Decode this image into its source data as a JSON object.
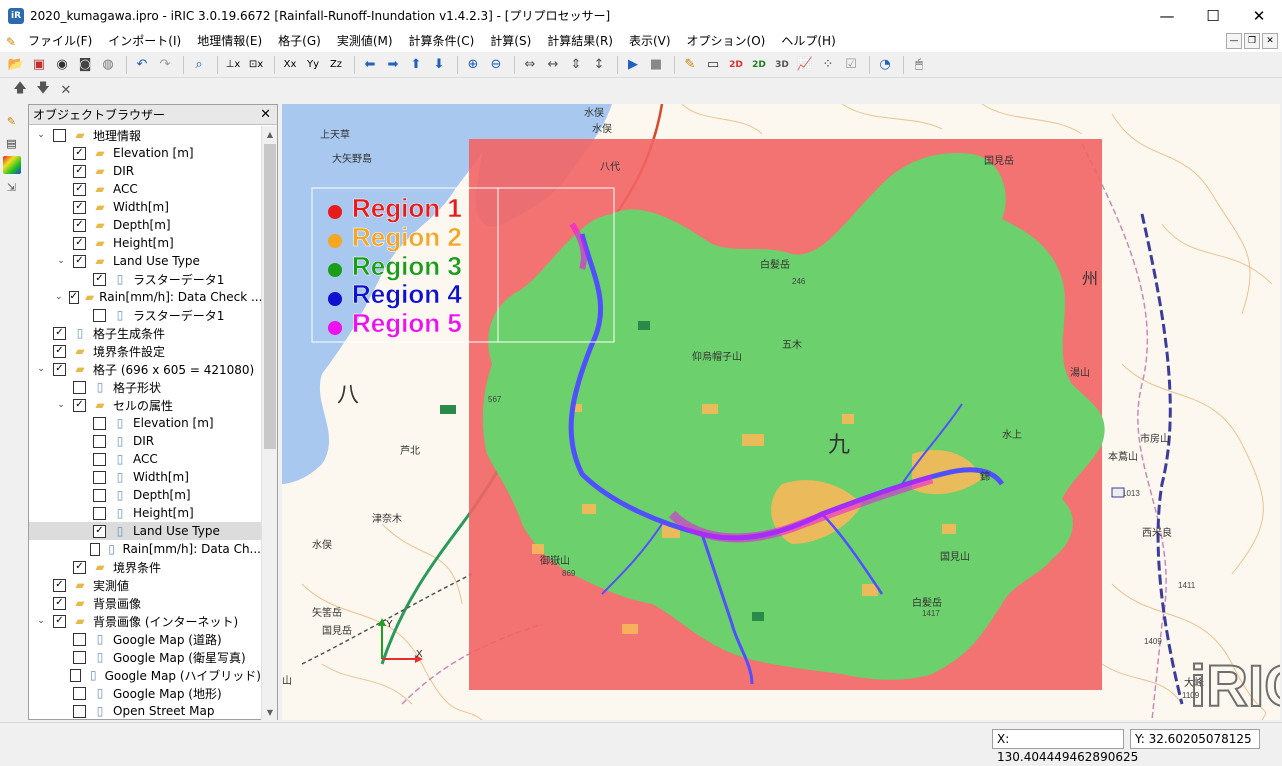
{
  "window": {
    "title": "2020_kumagawa.ipro - iRIC 3.0.19.6672 [Rainfall-Runoff-Inundation v1.4.2.3] - [プリプロセッサー]",
    "app_icon": "iRIC-app-icon",
    "controls": [
      "minimize-icon",
      "maximize-icon",
      "close-icon"
    ]
  },
  "menu": [
    "ファイル(F)",
    "インポート(I)",
    "地理情報(E)",
    "格子(G)",
    "実測値(M)",
    "計算条件(C)",
    "計算(S)",
    "計算結果(R)",
    "表示(V)",
    "オプション(O)",
    "ヘルプ(H)"
  ],
  "toolbar": {
    "icons": [
      "open-folder-icon",
      "save-icon",
      "disk-icon",
      "save-as-icon",
      "cd-icon",
      "undo-icon",
      "redo-icon",
      "zoom-box-icon",
      "x-axis-icon",
      "axis-scale-icon",
      "reverse-x-icon",
      "reverse-y-icon",
      "reverse-z-icon",
      "arrow-left-icon",
      "arrow-right-icon",
      "arrow-up-icon",
      "arrow-down-icon",
      "zoom-in-icon",
      "zoom-out-icon",
      "move-h-icon",
      "move-h2-icon",
      "move-v-icon",
      "move-v2-icon",
      "run-icon",
      "stop-icon",
      "pencil-icon",
      "screen-icon",
      "color-2d-icon",
      "grid-2d-icon",
      "view-3d-icon",
      "graph-icon",
      "scatter-icon",
      "check-icon",
      "globe-icon",
      "mouse-icon"
    ]
  },
  "toolbar2": {
    "icons": [
      "move-up-icon",
      "move-down-icon",
      "delete-icon"
    ]
  },
  "side_tools": [
    "edit-properties-icon",
    "display-setting-icon",
    "colormap-icon",
    "attribute-browser-icon"
  ],
  "object_browser": {
    "title": "オブジェクトブラウザー",
    "close_icon": "close-icon",
    "items": [
      {
        "label": "地理情報",
        "level": 0,
        "expand": "v",
        "checked": false,
        "icon": "folder-icon"
      },
      {
        "label": "Elevation [m]",
        "level": 1,
        "expand": "",
        "checked": true,
        "icon": "folder-icon"
      },
      {
        "label": "DIR",
        "level": 1,
        "expand": "",
        "checked": true,
        "icon": "folder-icon"
      },
      {
        "label": "ACC",
        "level": 1,
        "expand": "",
        "checked": true,
        "icon": "folder-icon"
      },
      {
        "label": "Width[m]",
        "level": 1,
        "expand": "",
        "checked": true,
        "icon": "folder-icon"
      },
      {
        "label": "Depth[m]",
        "level": 1,
        "expand": "",
        "checked": true,
        "icon": "folder-icon"
      },
      {
        "label": "Height[m]",
        "level": 1,
        "expand": "",
        "checked": true,
        "icon": "folder-icon"
      },
      {
        "label": "Land Use Type",
        "level": 1,
        "expand": "v",
        "checked": true,
        "icon": "folder-icon"
      },
      {
        "label": "ラスターデータ1",
        "level": 2,
        "expand": "",
        "checked": true,
        "icon": "document-icon"
      },
      {
        "label": "Rain[mm/h]: Data Check ...",
        "level": 1,
        "expand": "v",
        "checked": true,
        "icon": "folder-icon"
      },
      {
        "label": "ラスターデータ1",
        "level": 2,
        "expand": "",
        "checked": false,
        "icon": "document-icon"
      },
      {
        "label": "格子生成条件",
        "level": 0,
        "expand": "",
        "checked": true,
        "icon": "document-icon"
      },
      {
        "label": "境界条件設定",
        "level": 0,
        "expand": "",
        "checked": true,
        "icon": "folder-icon"
      },
      {
        "label": "格子 (696 x 605 = 421080)",
        "level": 0,
        "expand": "v",
        "checked": true,
        "icon": "folder-icon"
      },
      {
        "label": "格子形状",
        "level": 1,
        "expand": "",
        "checked": false,
        "icon": "document-icon"
      },
      {
        "label": "セルの属性",
        "level": 1,
        "expand": "v",
        "checked": true,
        "icon": "folder-icon"
      },
      {
        "label": "Elevation [m]",
        "level": 2,
        "expand": "",
        "checked": false,
        "icon": "document-icon"
      },
      {
        "label": "DIR",
        "level": 2,
        "expand": "",
        "checked": false,
        "icon": "document-icon"
      },
      {
        "label": "ACC",
        "level": 2,
        "expand": "",
        "checked": false,
        "icon": "document-icon"
      },
      {
        "label": "Width[m]",
        "level": 2,
        "expand": "",
        "checked": false,
        "icon": "document-icon"
      },
      {
        "label": "Depth[m]",
        "level": 2,
        "expand": "",
        "checked": false,
        "icon": "document-icon"
      },
      {
        "label": "Height[m]",
        "level": 2,
        "expand": "",
        "checked": false,
        "icon": "document-icon"
      },
      {
        "label": "Land Use Type",
        "level": 2,
        "expand": "",
        "checked": true,
        "icon": "document-icon",
        "selected": true
      },
      {
        "label": "Rain[mm/h]: Data Ch...",
        "level": 2,
        "expand": "",
        "checked": false,
        "icon": "document-icon"
      },
      {
        "label": "境界条件",
        "level": 1,
        "expand": "",
        "checked": true,
        "icon": "folder-icon"
      },
      {
        "label": "実測値",
        "level": 0,
        "expand": "",
        "checked": true,
        "icon": "folder-icon"
      },
      {
        "label": "背景画像",
        "level": 0,
        "expand": "",
        "checked": true,
        "icon": "folder-icon"
      },
      {
        "label": "背景画像 (インターネット)",
        "level": 0,
        "expand": "v",
        "checked": true,
        "icon": "folder-icon"
      },
      {
        "label": "Google Map (道路)",
        "level": 1,
        "expand": "",
        "checked": false,
        "icon": "document-icon"
      },
      {
        "label": "Google Map (衛星写真)",
        "level": 1,
        "expand": "",
        "checked": false,
        "icon": "document-icon"
      },
      {
        "label": "Google Map (ハイブリッド)",
        "level": 1,
        "expand": "",
        "checked": false,
        "icon": "document-icon"
      },
      {
        "label": "Google Map (地形)",
        "level": 1,
        "expand": "",
        "checked": false,
        "icon": "document-icon"
      },
      {
        "label": "Open Street Map",
        "level": 1,
        "expand": "",
        "checked": false,
        "icon": "document-icon"
      }
    ]
  },
  "map": {
    "legend": [
      {
        "label": "Region 1",
        "color": "#e81a1a"
      },
      {
        "label": "Region 2",
        "color": "#f5a623"
      },
      {
        "label": "Region 3",
        "color": "#1a9e1a"
      },
      {
        "label": "Region 4",
        "color": "#1010d0"
      },
      {
        "label": "Region 5",
        "color": "#ee10ee"
      }
    ],
    "labels": [
      "上天草",
      "大矢野島",
      "水俣",
      "水俣",
      "八代",
      "八",
      "国見岳",
      "白髪岳",
      "白髪岳",
      "五木",
      "水上",
      "湯山",
      "錦",
      "本蔦山",
      "西米良",
      "大峰",
      "九",
      "州",
      "市房山",
      "芦北",
      "津奈木",
      "水俣",
      "国見岳",
      "矢筈岳",
      "御嶽山",
      "仰烏帽子山",
      "国見山",
      "山"
    ],
    "numbers": [
      "567",
      "1417",
      "1409",
      "1109",
      "1013",
      "1411",
      "869",
      "246"
    ],
    "axis": {
      "x": "X",
      "y": "Y"
    },
    "logo": "iRIC",
    "colors": {
      "sea": "#a8c8f0",
      "land": "#fcf8ef",
      "region1": "#f26464",
      "region3": "#6cd06c"
    }
  },
  "status": {
    "x_coord": "X: 130.404449462890625",
    "y_coord": "Y: 32.60205078125"
  }
}
